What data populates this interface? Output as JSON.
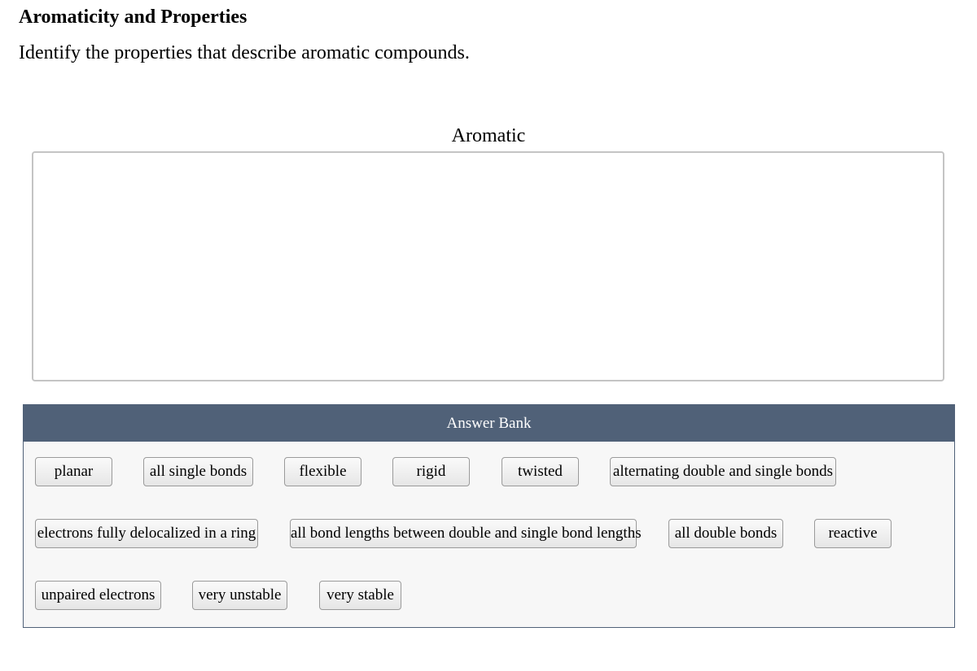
{
  "header": {
    "title": "Aromaticity and Properties",
    "prompt": "Identify the properties that describe aromatic compounds."
  },
  "drop_bin": {
    "label": "Aromatic",
    "items": []
  },
  "answer_bank": {
    "title": "Answer Bank",
    "items": [
      "planar",
      "all single bonds",
      "flexible",
      "rigid",
      "twisted",
      "alternating double and single bonds",
      "electrons fully delocalized in a ring",
      "all bond lengths between double and single bond lengths",
      "all double bonds",
      "reactive",
      "unpaired electrons",
      "very unstable",
      "very stable"
    ]
  }
}
